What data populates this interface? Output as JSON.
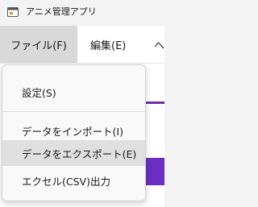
{
  "window": {
    "title": "アニメ管理アプリ",
    "icon": "app-window-icon"
  },
  "menubar": {
    "file": "ファイル(F)",
    "edit": "編集(E)",
    "view_partial": "ヘ"
  },
  "file_menu": {
    "items": [
      {
        "label": "設定(S)"
      },
      {
        "label": "データをインポート(I)"
      },
      {
        "label": "データをエクスポート(E)",
        "state": "hovered"
      },
      {
        "label": "エクセル(CSV)出力"
      }
    ]
  },
  "colors": {
    "accent": "#6a2fc2",
    "menu_active_bg": "#d9d9d9",
    "item_hover_bg": "#e0e0e0"
  }
}
